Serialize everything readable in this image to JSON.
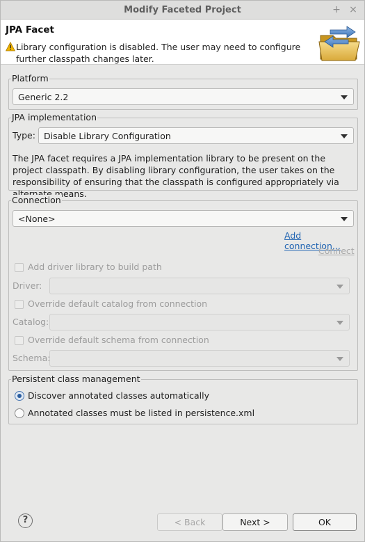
{
  "window": {
    "title": "Modify Faceted Project",
    "maximize_glyph": "+",
    "close_glyph": "×"
  },
  "header": {
    "title": "JPA Facet",
    "message": "Library configuration is disabled. The user may need to configure further classpath changes later.",
    "message_icon": "warning-icon",
    "banner_icon": "folder-icon"
  },
  "platform": {
    "legend": "Platform",
    "selected": "Generic 2.2"
  },
  "jpa_implementation": {
    "legend": "JPA implementation",
    "type_label": "Type:",
    "type_selected": "Disable Library Configuration",
    "description": "The JPA facet requires a JPA implementation library to be present on the project classpath. By disabling library configuration, the user takes on the responsibility of ensuring that the classpath is configured appropriately via alternate means."
  },
  "connection": {
    "legend": "Connection",
    "selected": "<None>",
    "add_connection_link": "Add connection...",
    "connect_link": "Connect",
    "add_driver_label": "Add driver library to build path",
    "driver_label": "Driver:",
    "override_catalog_label": "Override default catalog from connection",
    "catalog_label": "Catalog:",
    "override_schema_label": "Override default schema from connection",
    "schema_label": "Schema:"
  },
  "persistent": {
    "legend": "Persistent class management",
    "option_discover": "Discover annotated classes automatically",
    "option_listed": "Annotated classes must be listed in persistence.xml",
    "selected_option": "Discover annotated classes automatically"
  },
  "buttons": {
    "help_glyph": "?",
    "back": "< Back",
    "next": "Next >",
    "ok": "OK"
  },
  "colors": {
    "link": "#1f63b2",
    "warning": "#f0b400",
    "radio_selected": "#2a5d9f"
  }
}
